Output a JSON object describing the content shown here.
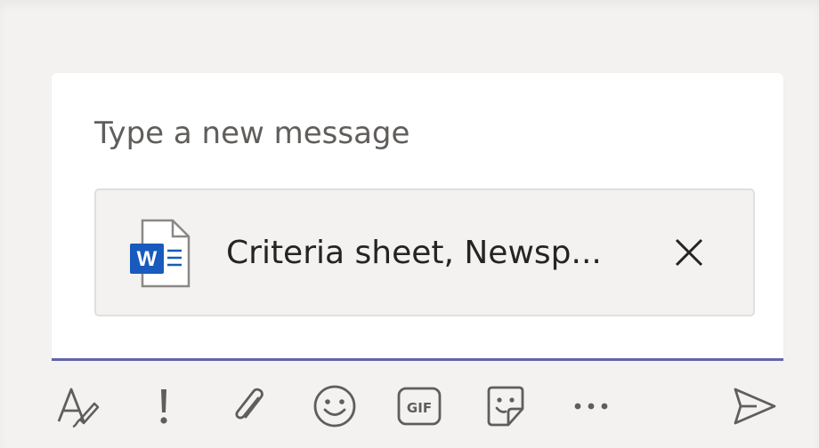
{
  "compose": {
    "placeholder": "Type a new message"
  },
  "attachment": {
    "name": "Criteria sheet, Newsp...",
    "icon": "word-document-icon",
    "icon_letter": "W"
  },
  "toolbar": {
    "items": [
      {
        "name": "format",
        "icon": "format-icon"
      },
      {
        "name": "important",
        "icon": "exclamation-icon"
      },
      {
        "name": "attach",
        "icon": "paperclip-icon"
      },
      {
        "name": "emoji",
        "icon": "emoji-icon"
      },
      {
        "name": "gif",
        "icon": "gif-icon",
        "label": "GIF"
      },
      {
        "name": "sticker",
        "icon": "sticker-icon"
      },
      {
        "name": "more",
        "icon": "more-options-icon"
      },
      {
        "name": "send",
        "icon": "send-icon"
      }
    ]
  },
  "colors": {
    "accent": "#6264a7",
    "word_blue": "#185abd",
    "background": "#f3f2f1",
    "icon_color": "#605e5c"
  }
}
